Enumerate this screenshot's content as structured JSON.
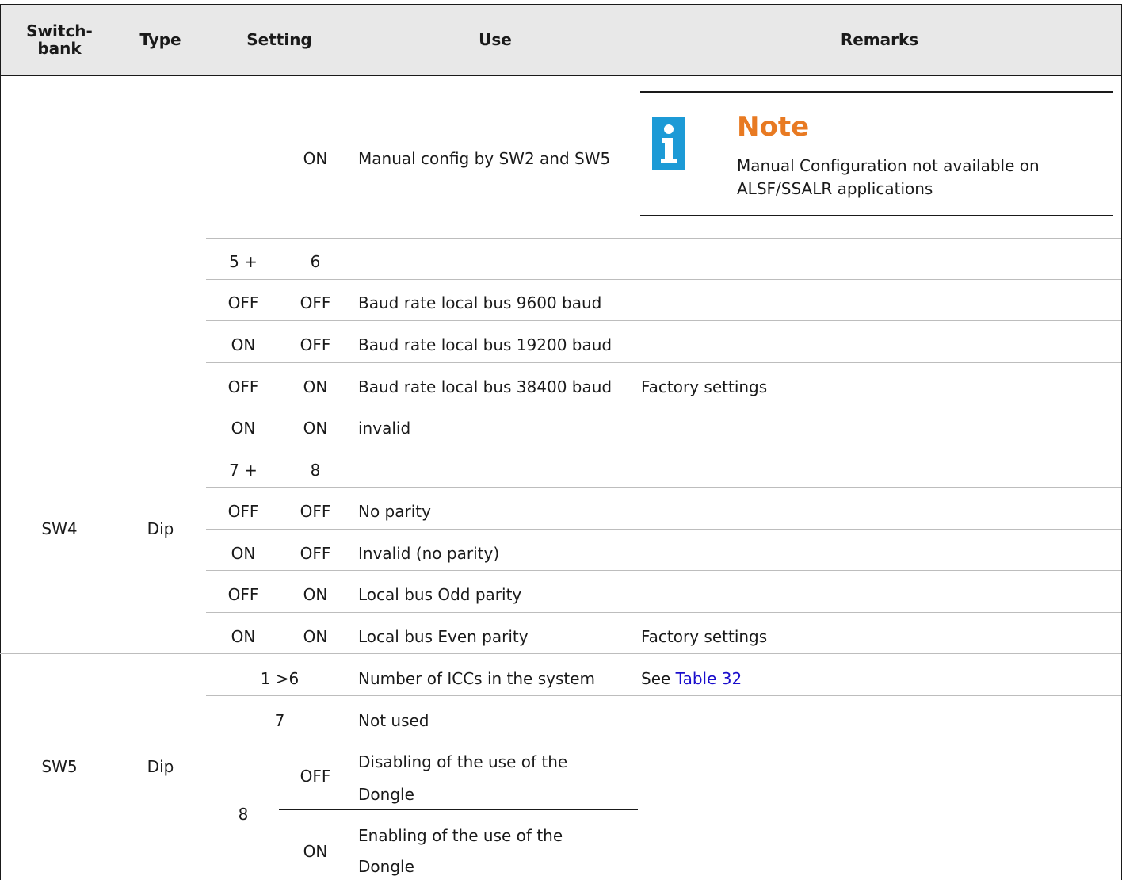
{
  "header": {
    "switch_bank": "Switch-bank",
    "switch_bank_l1": "Switch-",
    "switch_bank_l2": "bank",
    "type": "Type",
    "setting": "Setting",
    "use": "Use",
    "remarks": "Remarks"
  },
  "note": {
    "icon": "info-icon",
    "title": "Note",
    "text": "Manual Configuration not available on ALSF/SSALR applications",
    "accent_color": "#e87a22",
    "icon_color": "#1c9ad6"
  },
  "sw4": {
    "bank": "SW4",
    "type": "Dip",
    "rows": [
      {
        "s1": "",
        "s2": "ON",
        "use": "Manual config by SW2 and SW5",
        "remarks": ""
      },
      {
        "s1": "5 +",
        "s2": "6",
        "use": "",
        "remarks": ""
      },
      {
        "s1": "OFF",
        "s2": "OFF",
        "use": "Baud rate local bus 9600 baud",
        "remarks": ""
      },
      {
        "s1": "ON",
        "s2": "OFF",
        "use": "Baud rate local bus 19200 baud",
        "remarks": ""
      },
      {
        "s1": "OFF",
        "s2": "ON",
        "use": "Baud rate local bus 38400 baud",
        "remarks": "Factory settings"
      },
      {
        "s1": "ON",
        "s2": "ON",
        "use": "invalid",
        "remarks": ""
      },
      {
        "s1": "7 +",
        "s2": "8",
        "use": "",
        "remarks": ""
      },
      {
        "s1": "OFF",
        "s2": "OFF",
        "use": "No parity",
        "remarks": ""
      },
      {
        "s1": "ON",
        "s2": "OFF",
        "use": "Invalid (no parity)",
        "remarks": ""
      },
      {
        "s1": "OFF",
        "s2": "ON",
        "use": "Local bus Odd parity",
        "remarks": ""
      },
      {
        "s1": "ON",
        "s2": "ON",
        "use": "Local bus Even parity",
        "remarks": "Factory settings"
      }
    ]
  },
  "sw5": {
    "bank": "SW5",
    "type": "Dip",
    "row_iccs": {
      "setting": "1 >6",
      "use": "Number of ICCs in the system",
      "remarks_prefix": "See ",
      "remarks_link": "Table 32"
    },
    "row_notused": {
      "setting": "7",
      "use": "Not used"
    },
    "row_8": {
      "setting": "8",
      "off": {
        "state": "OFF",
        "use_l1": "Disabling of the use of the",
        "use_l2": "Dongle"
      },
      "on": {
        "state": "ON",
        "use_l1": "Enabling of the use of the",
        "use_l2": "Dongle"
      }
    }
  }
}
